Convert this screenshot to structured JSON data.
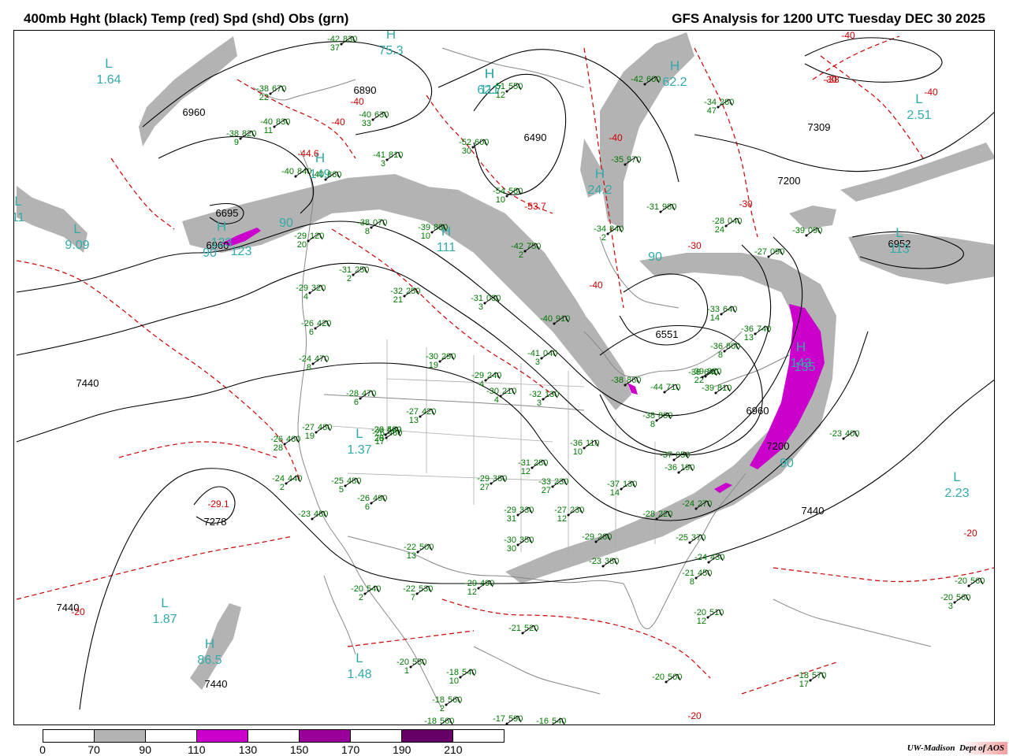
{
  "title_left": "400mb Hght (black) Temp (red) Spd (shd) Obs (grn)",
  "title_right": "GFS Analysis for 1200 UTC Tuesday  DEC 30 2025",
  "credit": {
    "institution": "UW-Madison",
    "dept": "Dept of AOS"
  },
  "colors": {
    "height_contour": "#000000",
    "temp_contour": "#cc0000",
    "obs": "#007700",
    "center_label": "#33aaaa",
    "speed_70_90": "#b3b3b3",
    "speed_110_130": "#cc00cc",
    "speed_150_170": "#990099",
    "speed_190_210": "#660066",
    "coast_border": "#888888"
  },
  "legend": {
    "ticks": [
      "0",
      "70",
      "90",
      "110",
      "130",
      "150",
      "170",
      "190",
      "210"
    ],
    "fills": [
      "#ffffff",
      "#b3b3b3",
      "#ffffff",
      "#cc00cc",
      "#ffffff",
      "#990099",
      "#ffffff",
      "#660066",
      "#ffffff"
    ]
  },
  "height_labels": [
    "7440",
    "6890",
    "6960",
    "6695",
    "6960",
    "6551",
    "7309",
    "7200",
    "6952",
    "6960",
    "7200",
    "7440",
    "7278",
    "7440",
    "7440",
    "6490"
  ],
  "temp_labels": [
    "-40",
    "-40",
    "-44.6",
    "-40",
    "-30",
    "-40",
    "-53.7",
    "-40",
    "-30",
    "-29.1",
    "-30",
    "-20",
    "-20",
    "-20",
    "-38",
    "-40"
  ],
  "centers": [
    {
      "letter": "L",
      "value": "1.64"
    },
    {
      "letter": "L",
      "value": "9.09"
    },
    {
      "letter": "H",
      "value": "75.3"
    },
    {
      "letter": "H",
      "value": "62.7"
    },
    {
      "letter": "H",
      "value": "62.2"
    },
    {
      "letter": "H",
      "value": "24.2"
    },
    {
      "letter": "L",
      "value": "2.51"
    },
    {
      "letter": "H",
      "value": "149"
    },
    {
      "letter": "H",
      "value": "123"
    },
    {
      "letter": "H",
      "value": "111"
    },
    {
      "letter": "L",
      "value": "113"
    },
    {
      "letter": "H",
      "value": "143"
    },
    {
      "letter": "L",
      "value": "1.37"
    },
    {
      "letter": "L",
      "value": "2.23"
    },
    {
      "letter": "L",
      "value": "1.87"
    },
    {
      "letter": "H",
      "value": "86.5"
    },
    {
      "letter": "L",
      "value": "1.48"
    },
    {
      "letter": "H",
      "value": "111"
    },
    {
      "letter": "L",
      "value": "11"
    }
  ],
  "speed_labels": [
    "90",
    "90",
    "90",
    "90",
    "135",
    "123"
  ],
  "obs": [
    {
      "t": "-42",
      "h": "830",
      "d": "37"
    },
    {
      "t": "-38",
      "h": "670",
      "d": "22"
    },
    {
      "t": "-40",
      "h": "830",
      "d": "11"
    },
    {
      "t": "-38",
      "h": "820",
      "d": "9"
    },
    {
      "t": "-40",
      "h": "840",
      "d": ""
    },
    {
      "t": "-40",
      "h": "860",
      "d": ""
    },
    {
      "t": "-40",
      "h": "630",
      "d": "33"
    },
    {
      "t": "-41",
      "h": "810",
      "d": "3"
    },
    {
      "t": "-52",
      "h": "600",
      "d": "30"
    },
    {
      "t": "-51",
      "h": "550",
      "d": "12"
    },
    {
      "t": "-54",
      "h": "580",
      "d": "10"
    },
    {
      "t": "-42",
      "h": "600",
      "d": ""
    },
    {
      "t": "-34",
      "h": "280",
      "d": "47"
    },
    {
      "t": "-35",
      "h": "970",
      "d": ""
    },
    {
      "t": "-31",
      "h": "980",
      "d": ""
    },
    {
      "t": "-28",
      "h": "040",
      "d": "24"
    },
    {
      "t": "-34",
      "h": "840",
      "d": "2"
    },
    {
      "t": "-39",
      "h": "090",
      "d": ""
    },
    {
      "t": "-27",
      "h": "090",
      "d": ""
    },
    {
      "t": "-38",
      "h": "070",
      "d": "8"
    },
    {
      "t": "-39",
      "h": "880",
      "d": "10"
    },
    {
      "t": "-42",
      "h": "750",
      "d": "2"
    },
    {
      "t": "-29",
      "h": "120",
      "d": "20"
    },
    {
      "t": "-31",
      "h": "250",
      "d": "2"
    },
    {
      "t": "-32",
      "h": "250",
      "d": "21"
    },
    {
      "t": "-31",
      "h": "030",
      "d": "3"
    },
    {
      "t": "-29",
      "h": "320",
      "d": "4"
    },
    {
      "t": "-26",
      "h": "420",
      "d": "6"
    },
    {
      "t": "-24",
      "h": "470",
      "d": "8"
    },
    {
      "t": "-40",
      "h": "910",
      "d": ""
    },
    {
      "t": "-41",
      "h": "040",
      "d": "3"
    },
    {
      "t": "-30",
      "h": "290",
      "d": "19"
    },
    {
      "t": "-29",
      "h": "240",
      "d": "4"
    },
    {
      "t": "-30",
      "h": "210",
      "d": "4"
    },
    {
      "t": "-32",
      "h": "130",
      "d": "3"
    },
    {
      "t": "-28",
      "h": "470",
      "d": "6"
    },
    {
      "t": "-27",
      "h": "420",
      "d": "13"
    },
    {
      "t": "-27",
      "h": "480",
      "d": "19"
    },
    {
      "t": "-26",
      "h": "460",
      "d": "28"
    },
    {
      "t": "-26",
      "h": "480",
      "d": "17"
    },
    {
      "t": "-36",
      "h": "110",
      "d": "10"
    },
    {
      "t": "-31",
      "h": "280",
      "d": "12"
    },
    {
      "t": "-33",
      "h": "230",
      "d": "27"
    },
    {
      "t": "-29",
      "h": "380",
      "d": "27"
    },
    {
      "t": "-24",
      "h": "440",
      "d": "2"
    },
    {
      "t": "-25",
      "h": "480",
      "d": "5"
    },
    {
      "t": "-26",
      "h": "490",
      "d": "6"
    },
    {
      "t": "-23",
      "h": "480",
      "d": ""
    },
    {
      "t": "-29",
      "h": "330",
      "d": "31"
    },
    {
      "t": "-27",
      "h": "230",
      "d": "12"
    },
    {
      "t": "-37",
      "h": "130",
      "d": "14"
    },
    {
      "t": "-30",
      "h": "350",
      "d": "30"
    },
    {
      "t": "-29",
      "h": "280",
      "d": ""
    },
    {
      "t": "-22",
      "h": "500",
      "d": "13"
    },
    {
      "t": "-20",
      "h": "540",
      "d": "2"
    },
    {
      "t": "-22",
      "h": "530",
      "d": "7"
    },
    {
      "t": "-29",
      "h": "490",
      "d": "12"
    },
    {
      "t": "-21",
      "h": "520",
      "d": ""
    },
    {
      "t": "-23",
      "h": "380",
      "d": ""
    },
    {
      "t": "-33",
      "h": "640",
      "d": "14"
    },
    {
      "t": "-36",
      "h": "740",
      "d": "13"
    },
    {
      "t": "-36",
      "h": "800",
      "d": "8"
    },
    {
      "t": "-39",
      "h": "820",
      "d": "22"
    },
    {
      "t": "-39",
      "h": "810",
      "d": ""
    },
    {
      "t": "-36",
      "h": "640",
      "d": ""
    },
    {
      "t": "-38",
      "h": "860",
      "d": ""
    },
    {
      "t": "-44",
      "h": "710",
      "d": ""
    },
    {
      "t": "-38",
      "h": "880",
      "d": "8"
    },
    {
      "t": "-37",
      "h": "050",
      "d": ""
    },
    {
      "t": "-36",
      "h": "190",
      "d": ""
    },
    {
      "t": "-28",
      "h": "220",
      "d": ""
    },
    {
      "t": "-24",
      "h": "270",
      "d": ""
    },
    {
      "t": "-25",
      "h": "370",
      "d": ""
    },
    {
      "t": "-24",
      "h": "430",
      "d": ""
    },
    {
      "t": "-21",
      "h": "450",
      "d": "8"
    },
    {
      "t": "-20",
      "h": "510",
      "d": "12"
    },
    {
      "t": "-23",
      "h": "400",
      "d": ""
    },
    {
      "t": "-20",
      "h": "560",
      "d": ""
    },
    {
      "t": "-20",
      "h": "560",
      "d": "3"
    },
    {
      "t": "-18",
      "h": "570",
      "d": "17"
    },
    {
      "t": "-20",
      "h": "550",
      "d": "1"
    },
    {
      "t": "-18",
      "h": "540",
      "d": "10"
    },
    {
      "t": "-18",
      "h": "560",
      "d": "2"
    },
    {
      "t": "-18",
      "h": "560",
      "d": ""
    },
    {
      "t": "-17",
      "h": "590",
      "d": ""
    },
    {
      "t": "-16",
      "h": "540",
      "d": ""
    },
    {
      "t": "-20",
      "h": "500",
      "d": ""
    },
    {
      "t": "-20",
      "h": "560",
      "d": "5"
    },
    {
      "t": "-26",
      "h": "480",
      "d": "20"
    },
    {
      "t": "-26",
      "h": "480",
      "d": ""
    }
  ]
}
